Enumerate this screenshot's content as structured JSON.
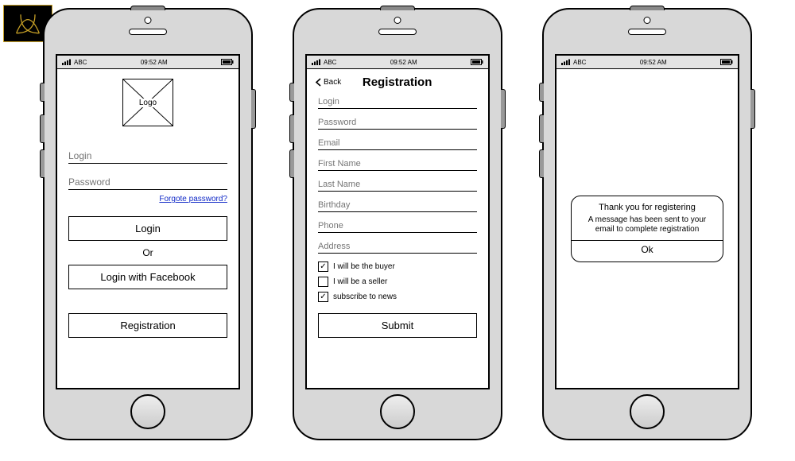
{
  "status": {
    "carrier": "ABC",
    "time": "09:52 AM"
  },
  "screen1": {
    "logo_text": "Logo",
    "login_label": "Login",
    "password_label": "Password",
    "forgot_label": "Forgote password?",
    "login_btn": "Login",
    "or_label": "Or",
    "fb_btn": "Login with Facebook",
    "register_btn": "Registration"
  },
  "screen2": {
    "back_label": "Back",
    "title": "Registration",
    "fields": {
      "login": "Login",
      "password": "Password",
      "email": "Email",
      "first_name": "First Name",
      "last_name": "Last Name",
      "birthday": "Birthday",
      "phone": "Phone",
      "address": "Address"
    },
    "checks": {
      "buyer": {
        "label": "I will be the buyer",
        "checked": true
      },
      "seller": {
        "label": "I will be a seller",
        "checked": false
      },
      "news": {
        "label": "subscribe to news",
        "checked": true
      }
    },
    "submit_btn": "Submit"
  },
  "screen3": {
    "dialog_title": "Thank you for registering",
    "dialog_body": "A message has been sent to your email to complete registration",
    "ok_label": "Ok"
  }
}
